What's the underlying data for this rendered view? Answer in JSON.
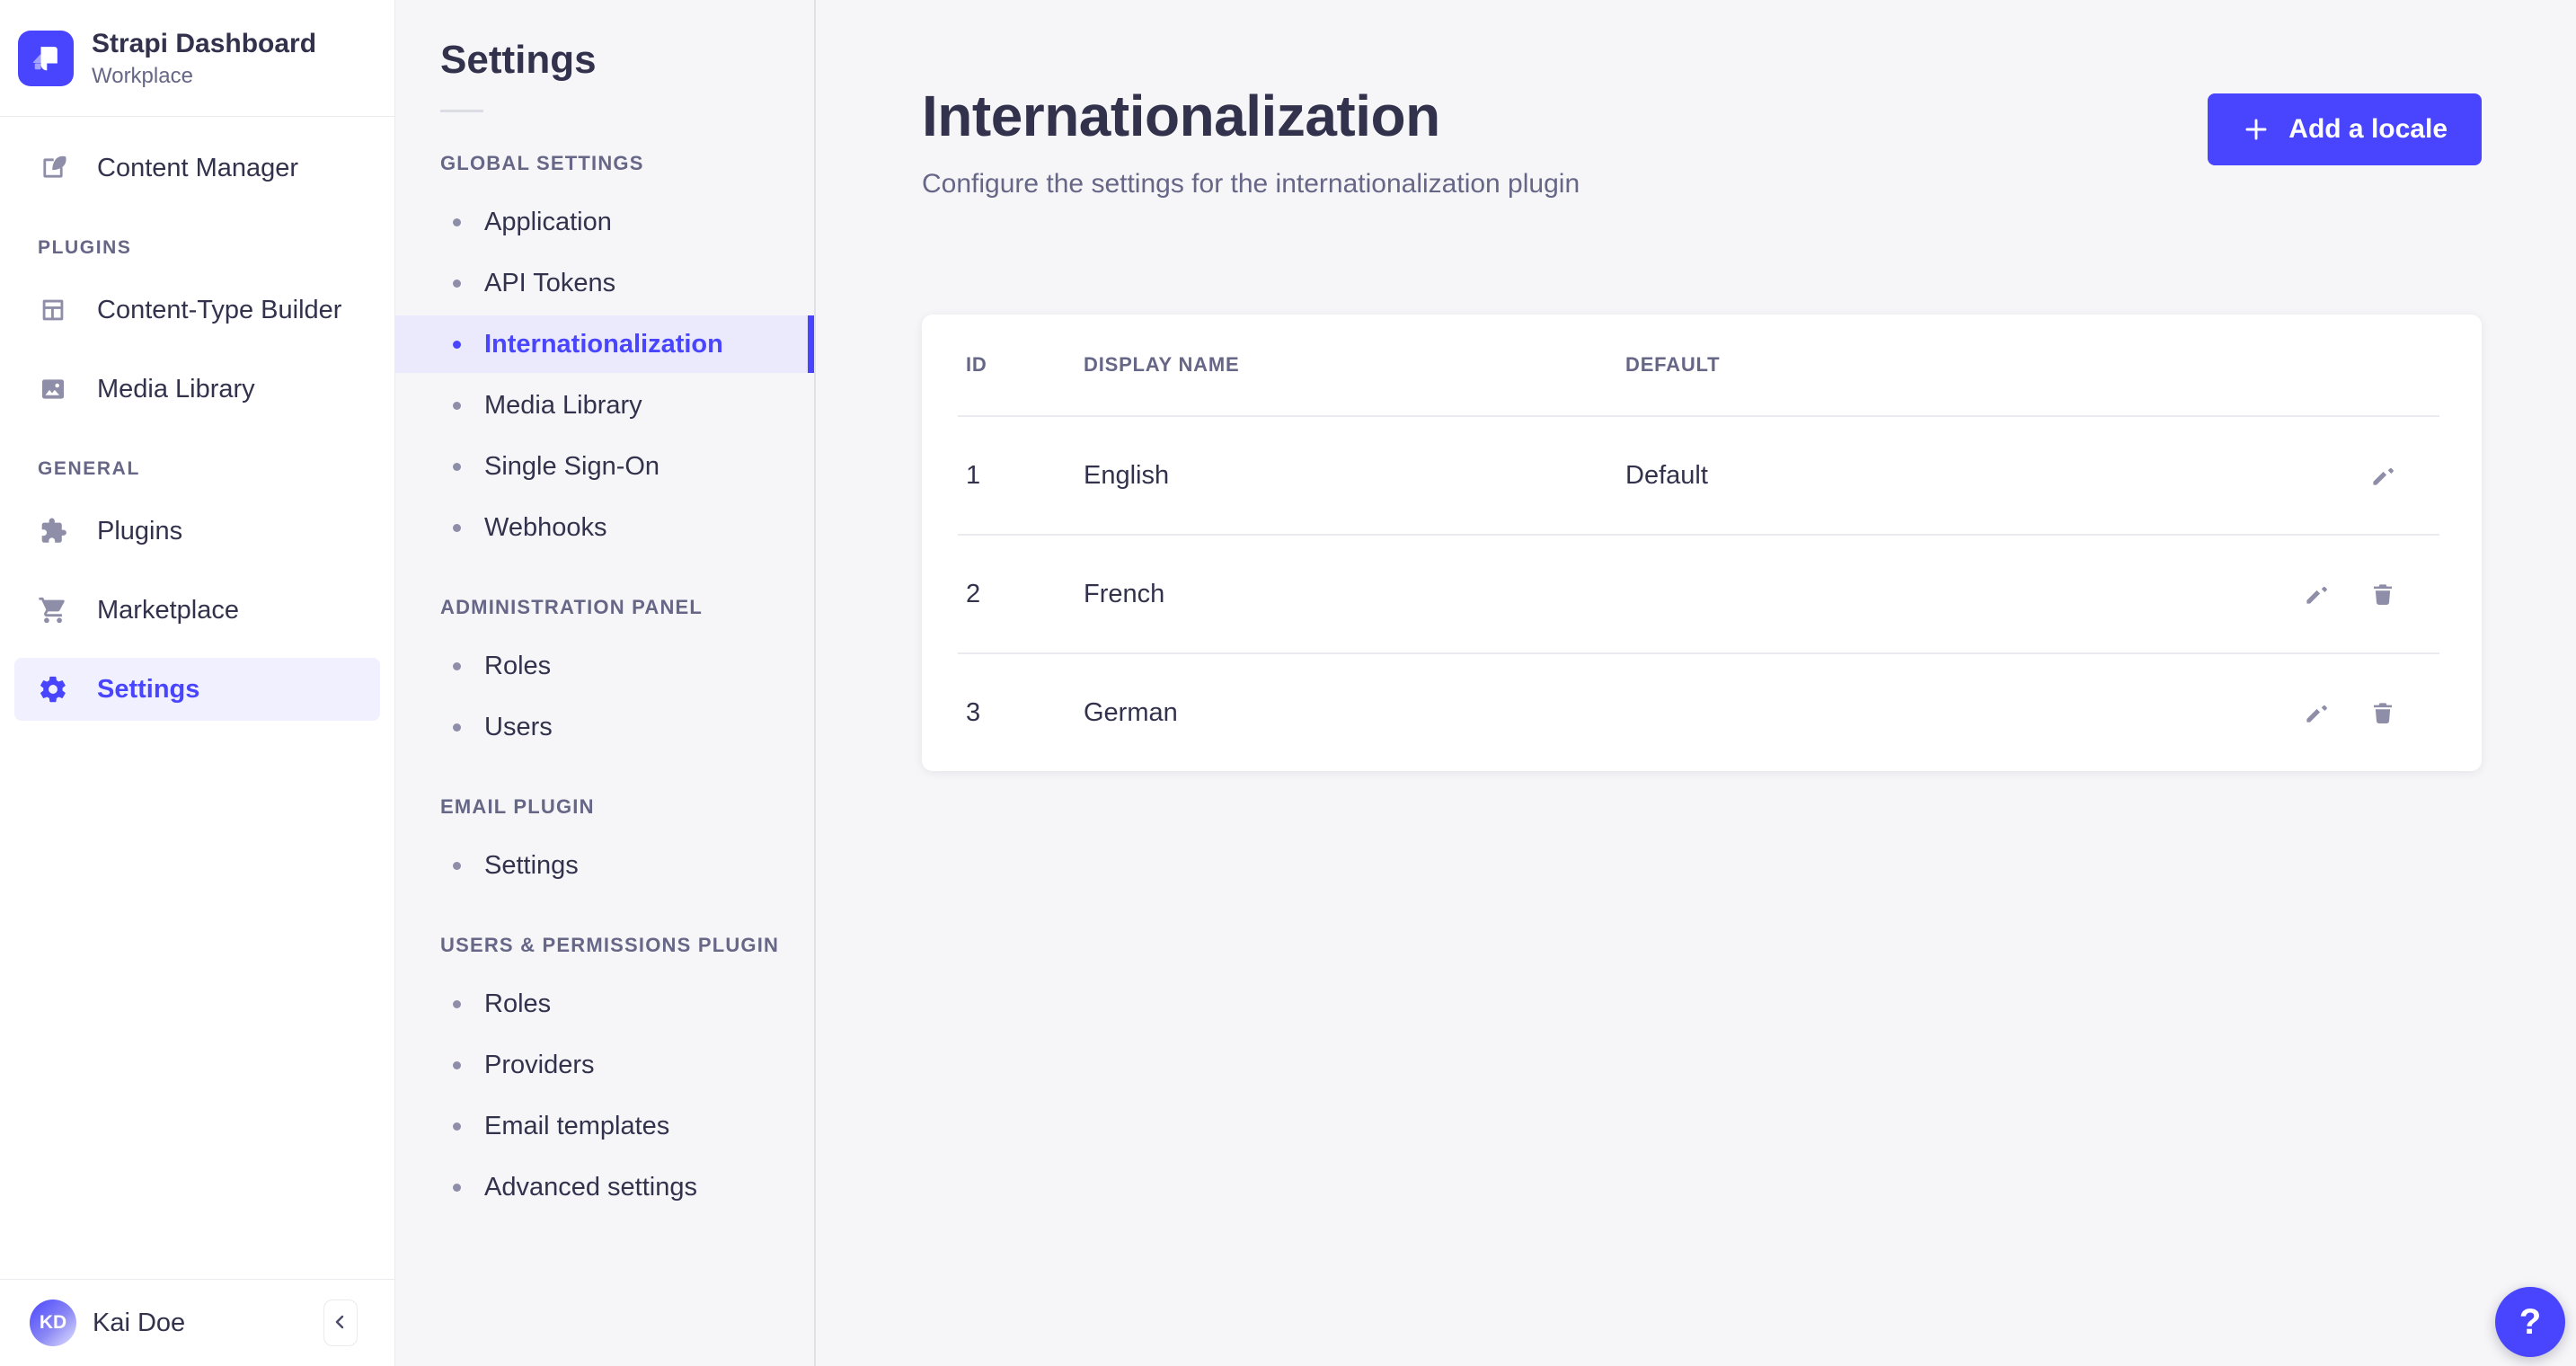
{
  "brand": {
    "title": "Strapi Dashboard",
    "subtitle": "Workplace",
    "logo_icon": "strapi-logo"
  },
  "mainnav": {
    "sections": [
      {
        "label": "",
        "items": [
          {
            "label": "Content Manager",
            "icon": "content-manager-icon",
            "active": false
          }
        ]
      },
      {
        "label": "PLUGINS",
        "items": [
          {
            "label": "Content-Type Builder",
            "icon": "content-type-builder-icon",
            "active": false
          },
          {
            "label": "Media Library",
            "icon": "media-library-icon",
            "active": false
          }
        ]
      },
      {
        "label": "GENERAL",
        "items": [
          {
            "label": "Plugins",
            "icon": "plugins-icon",
            "active": false
          },
          {
            "label": "Marketplace",
            "icon": "marketplace-icon",
            "active": false
          },
          {
            "label": "Settings",
            "icon": "settings-gear-icon",
            "active": true
          }
        ]
      }
    ]
  },
  "user": {
    "name": "Kai Doe",
    "initials": "KD"
  },
  "footer": {
    "collapse_icon": "chevron-left-icon"
  },
  "subnav": {
    "title": "Settings",
    "sections": [
      {
        "label": "GLOBAL SETTINGS",
        "items": [
          {
            "label": "Application",
            "active": false
          },
          {
            "label": "API Tokens",
            "active": false
          },
          {
            "label": "Internationalization",
            "active": true
          },
          {
            "label": "Media Library",
            "active": false
          },
          {
            "label": "Single Sign-On",
            "active": false
          },
          {
            "label": "Webhooks",
            "active": false
          }
        ]
      },
      {
        "label": "ADMINISTRATION PANEL",
        "items": [
          {
            "label": "Roles",
            "active": false
          },
          {
            "label": "Users",
            "active": false
          }
        ]
      },
      {
        "label": "EMAIL PLUGIN",
        "items": [
          {
            "label": "Settings",
            "active": false
          }
        ]
      },
      {
        "label": "USERS & PERMISSIONS PLUGIN",
        "items": [
          {
            "label": "Roles",
            "active": false
          },
          {
            "label": "Providers",
            "active": false
          },
          {
            "label": "Email templates",
            "active": false
          },
          {
            "label": "Advanced settings",
            "active": false
          }
        ]
      }
    ]
  },
  "page": {
    "title": "Internationalization",
    "subtitle": "Configure the settings for the internationalization plugin",
    "add_button": {
      "label": "Add a locale",
      "icon": "plus-icon"
    }
  },
  "table": {
    "columns": [
      "ID",
      "DISPLAY NAME",
      "DEFAULT"
    ],
    "rows": [
      {
        "id": "1",
        "display_name": "English",
        "default": "Default",
        "actions": [
          "edit"
        ]
      },
      {
        "id": "2",
        "display_name": "French",
        "default": "",
        "actions": [
          "edit",
          "delete"
        ]
      },
      {
        "id": "3",
        "display_name": "German",
        "default": "",
        "actions": [
          "edit",
          "delete"
        ]
      }
    ]
  },
  "help": {
    "label": "?"
  },
  "appearance": {
    "accent_color": "#4945ff",
    "mainnav_active_bg": "#f0f0ff",
    "subnav_active_bg": "#eaeafc",
    "page_bg": "#f6f6f9",
    "card_bg": "#ffffff",
    "text_primary": "#32324d",
    "text_muted": "#666687",
    "icon_muted": "#8e8ea9",
    "border": "#eaeaef"
  }
}
